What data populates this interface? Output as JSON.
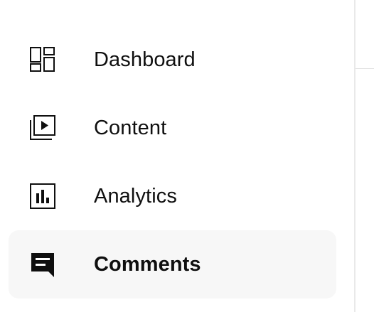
{
  "sidebar": {
    "items": [
      {
        "label": "Dashboard",
        "icon": "dashboard-icon",
        "active": false
      },
      {
        "label": "Content",
        "icon": "content-icon",
        "active": false
      },
      {
        "label": "Analytics",
        "icon": "analytics-icon",
        "active": false
      },
      {
        "label": "Comments",
        "icon": "comments-icon",
        "active": true
      }
    ]
  },
  "colors": {
    "text": "#0f0f0f",
    "active_background": "#f7f7f7",
    "divider": "#e9e9e9"
  }
}
